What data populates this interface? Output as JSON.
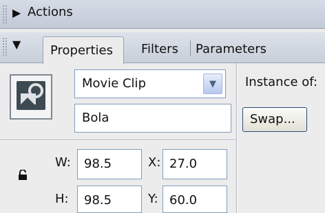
{
  "actions_panel": {
    "title": "Actions"
  },
  "properties_panel": {
    "tabs": [
      {
        "label": "Properties"
      },
      {
        "label": "Filters"
      },
      {
        "label": "Parameters"
      }
    ],
    "symbol_type": "Movie Clip",
    "instance_name": "Bola",
    "instance_of_label": "Instance of:",
    "swap_label": "Swap...",
    "w_label": "W:",
    "w_value": "98.5",
    "h_label": "H:",
    "h_value": "98.5",
    "x_label": "X:",
    "x_value": "27.0",
    "y_label": "Y:",
    "y_value": "60.0"
  },
  "icons": [
    "grip-icon",
    "expand-arrow-icon",
    "movie-clip-symbol-icon",
    "dropdown-arrow-icon",
    "lock-icon"
  ],
  "colors": {
    "panel_bg": "#ececec",
    "header_gradient_top": "#d6dce6",
    "field_border": "#7f9db9"
  }
}
